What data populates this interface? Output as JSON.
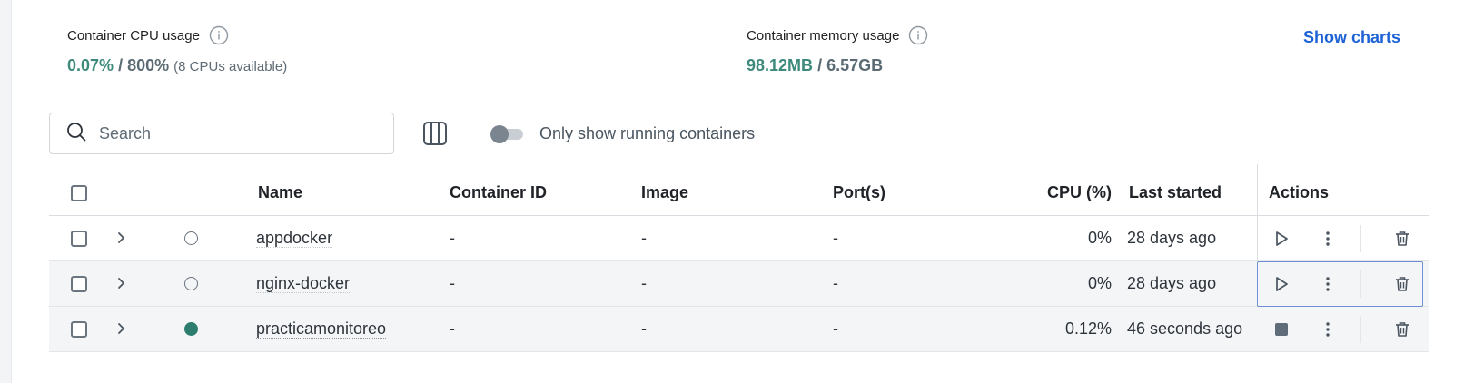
{
  "stats": {
    "cpu": {
      "label": "Container CPU usage",
      "value": "0.07%",
      "separator": "/",
      "max": "800%",
      "note": "(8 CPUs available)"
    },
    "memory": {
      "label": "Container memory usage",
      "value": "98.12MB",
      "separator": "/",
      "max": "6.57GB"
    }
  },
  "show_charts_label": "Show charts",
  "search": {
    "placeholder": "Search",
    "value": ""
  },
  "toggle": {
    "label": "Only show running containers",
    "on": false
  },
  "table": {
    "headers": {
      "name": "Name",
      "container_id": "Container ID",
      "image": "Image",
      "ports": "Port(s)",
      "cpu": "CPU (%)",
      "last_started": "Last started",
      "actions": "Actions"
    },
    "rows": [
      {
        "name": "appdocker",
        "container_id": "-",
        "image": "-",
        "ports": "-",
        "cpu": "0%",
        "last_started": "28 days ago",
        "status": "stopped"
      },
      {
        "name": "nginx-docker",
        "container_id": "-",
        "image": "-",
        "ports": "-",
        "cpu": "0%",
        "last_started": "28 days ago",
        "status": "stopped"
      },
      {
        "name": "practicamonitoreo",
        "container_id": "-",
        "image": "-",
        "ports": "-",
        "cpu": "0.12%",
        "last_started": "46 seconds ago",
        "status": "running"
      }
    ]
  },
  "colors": {
    "accent_green": "#3d8a7c",
    "link_blue": "#1e63d6",
    "running_status": "#2c7d6e"
  },
  "icons": {
    "info": "info-circle-icon",
    "search": "search-icon",
    "columns": "columns-icon",
    "expand": "chevron-right-icon",
    "start": "play-icon",
    "stop": "stop-square-icon",
    "more": "more-vertical-icon",
    "delete": "trash-icon"
  }
}
